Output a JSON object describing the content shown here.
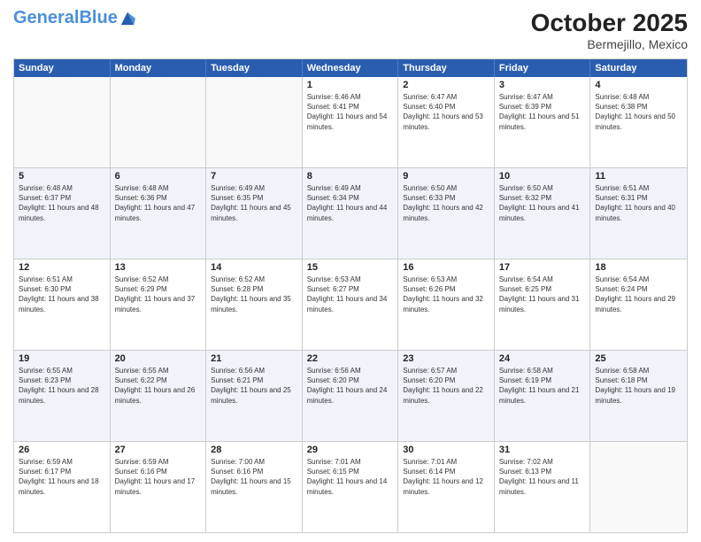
{
  "header": {
    "logo_general": "General",
    "logo_blue": "Blue",
    "month_year": "October 2025",
    "location": "Bermejillo, Mexico"
  },
  "days_of_week": [
    "Sunday",
    "Monday",
    "Tuesday",
    "Wednesday",
    "Thursday",
    "Friday",
    "Saturday"
  ],
  "weeks": [
    [
      {
        "day": "",
        "sunrise": "",
        "sunset": "",
        "daylight": "",
        "empty": true
      },
      {
        "day": "",
        "sunrise": "",
        "sunset": "",
        "daylight": "",
        "empty": true
      },
      {
        "day": "",
        "sunrise": "",
        "sunset": "",
        "daylight": "",
        "empty": true
      },
      {
        "day": "1",
        "sunrise": "Sunrise: 6:46 AM",
        "sunset": "Sunset: 6:41 PM",
        "daylight": "Daylight: 11 hours and 54 minutes.",
        "empty": false
      },
      {
        "day": "2",
        "sunrise": "Sunrise: 6:47 AM",
        "sunset": "Sunset: 6:40 PM",
        "daylight": "Daylight: 11 hours and 53 minutes.",
        "empty": false
      },
      {
        "day": "3",
        "sunrise": "Sunrise: 6:47 AM",
        "sunset": "Sunset: 6:39 PM",
        "daylight": "Daylight: 11 hours and 51 minutes.",
        "empty": false
      },
      {
        "day": "4",
        "sunrise": "Sunrise: 6:48 AM",
        "sunset": "Sunset: 6:38 PM",
        "daylight": "Daylight: 11 hours and 50 minutes.",
        "empty": false
      }
    ],
    [
      {
        "day": "5",
        "sunrise": "Sunrise: 6:48 AM",
        "sunset": "Sunset: 6:37 PM",
        "daylight": "Daylight: 11 hours and 48 minutes.",
        "empty": false
      },
      {
        "day": "6",
        "sunrise": "Sunrise: 6:48 AM",
        "sunset": "Sunset: 6:36 PM",
        "daylight": "Daylight: 11 hours and 47 minutes.",
        "empty": false
      },
      {
        "day": "7",
        "sunrise": "Sunrise: 6:49 AM",
        "sunset": "Sunset: 6:35 PM",
        "daylight": "Daylight: 11 hours and 45 minutes.",
        "empty": false
      },
      {
        "day": "8",
        "sunrise": "Sunrise: 6:49 AM",
        "sunset": "Sunset: 6:34 PM",
        "daylight": "Daylight: 11 hours and 44 minutes.",
        "empty": false
      },
      {
        "day": "9",
        "sunrise": "Sunrise: 6:50 AM",
        "sunset": "Sunset: 6:33 PM",
        "daylight": "Daylight: 11 hours and 42 minutes.",
        "empty": false
      },
      {
        "day": "10",
        "sunrise": "Sunrise: 6:50 AM",
        "sunset": "Sunset: 6:32 PM",
        "daylight": "Daylight: 11 hours and 41 minutes.",
        "empty": false
      },
      {
        "day": "11",
        "sunrise": "Sunrise: 6:51 AM",
        "sunset": "Sunset: 6:31 PM",
        "daylight": "Daylight: 11 hours and 40 minutes.",
        "empty": false
      }
    ],
    [
      {
        "day": "12",
        "sunrise": "Sunrise: 6:51 AM",
        "sunset": "Sunset: 6:30 PM",
        "daylight": "Daylight: 11 hours and 38 minutes.",
        "empty": false
      },
      {
        "day": "13",
        "sunrise": "Sunrise: 6:52 AM",
        "sunset": "Sunset: 6:29 PM",
        "daylight": "Daylight: 11 hours and 37 minutes.",
        "empty": false
      },
      {
        "day": "14",
        "sunrise": "Sunrise: 6:52 AM",
        "sunset": "Sunset: 6:28 PM",
        "daylight": "Daylight: 11 hours and 35 minutes.",
        "empty": false
      },
      {
        "day": "15",
        "sunrise": "Sunrise: 6:53 AM",
        "sunset": "Sunset: 6:27 PM",
        "daylight": "Daylight: 11 hours and 34 minutes.",
        "empty": false
      },
      {
        "day": "16",
        "sunrise": "Sunrise: 6:53 AM",
        "sunset": "Sunset: 6:26 PM",
        "daylight": "Daylight: 11 hours and 32 minutes.",
        "empty": false
      },
      {
        "day": "17",
        "sunrise": "Sunrise: 6:54 AM",
        "sunset": "Sunset: 6:25 PM",
        "daylight": "Daylight: 11 hours and 31 minutes.",
        "empty": false
      },
      {
        "day": "18",
        "sunrise": "Sunrise: 6:54 AM",
        "sunset": "Sunset: 6:24 PM",
        "daylight": "Daylight: 11 hours and 29 minutes.",
        "empty": false
      }
    ],
    [
      {
        "day": "19",
        "sunrise": "Sunrise: 6:55 AM",
        "sunset": "Sunset: 6:23 PM",
        "daylight": "Daylight: 11 hours and 28 minutes.",
        "empty": false
      },
      {
        "day": "20",
        "sunrise": "Sunrise: 6:55 AM",
        "sunset": "Sunset: 6:22 PM",
        "daylight": "Daylight: 11 hours and 26 minutes.",
        "empty": false
      },
      {
        "day": "21",
        "sunrise": "Sunrise: 6:56 AM",
        "sunset": "Sunset: 6:21 PM",
        "daylight": "Daylight: 11 hours and 25 minutes.",
        "empty": false
      },
      {
        "day": "22",
        "sunrise": "Sunrise: 6:56 AM",
        "sunset": "Sunset: 6:20 PM",
        "daylight": "Daylight: 11 hours and 24 minutes.",
        "empty": false
      },
      {
        "day": "23",
        "sunrise": "Sunrise: 6:57 AM",
        "sunset": "Sunset: 6:20 PM",
        "daylight": "Daylight: 11 hours and 22 minutes.",
        "empty": false
      },
      {
        "day": "24",
        "sunrise": "Sunrise: 6:58 AM",
        "sunset": "Sunset: 6:19 PM",
        "daylight": "Daylight: 11 hours and 21 minutes.",
        "empty": false
      },
      {
        "day": "25",
        "sunrise": "Sunrise: 6:58 AM",
        "sunset": "Sunset: 6:18 PM",
        "daylight": "Daylight: 11 hours and 19 minutes.",
        "empty": false
      }
    ],
    [
      {
        "day": "26",
        "sunrise": "Sunrise: 6:59 AM",
        "sunset": "Sunset: 6:17 PM",
        "daylight": "Daylight: 11 hours and 18 minutes.",
        "empty": false
      },
      {
        "day": "27",
        "sunrise": "Sunrise: 6:59 AM",
        "sunset": "Sunset: 6:16 PM",
        "daylight": "Daylight: 11 hours and 17 minutes.",
        "empty": false
      },
      {
        "day": "28",
        "sunrise": "Sunrise: 7:00 AM",
        "sunset": "Sunset: 6:16 PM",
        "daylight": "Daylight: 11 hours and 15 minutes.",
        "empty": false
      },
      {
        "day": "29",
        "sunrise": "Sunrise: 7:01 AM",
        "sunset": "Sunset: 6:15 PM",
        "daylight": "Daylight: 11 hours and 14 minutes.",
        "empty": false
      },
      {
        "day": "30",
        "sunrise": "Sunrise: 7:01 AM",
        "sunset": "Sunset: 6:14 PM",
        "daylight": "Daylight: 11 hours and 12 minutes.",
        "empty": false
      },
      {
        "day": "31",
        "sunrise": "Sunrise: 7:02 AM",
        "sunset": "Sunset: 6:13 PM",
        "daylight": "Daylight: 11 hours and 11 minutes.",
        "empty": false
      },
      {
        "day": "",
        "sunrise": "",
        "sunset": "",
        "daylight": "",
        "empty": true
      }
    ]
  ]
}
